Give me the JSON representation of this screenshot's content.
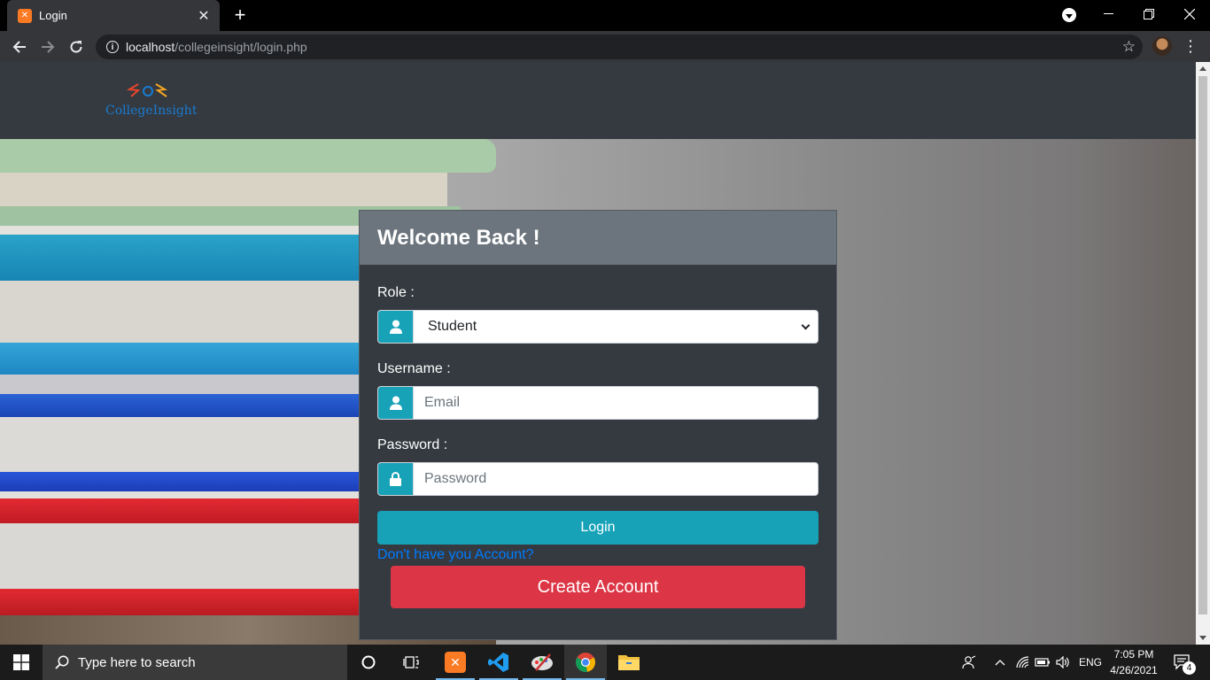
{
  "browser": {
    "tab_title": "Login",
    "url_host": "localhost",
    "url_path": "/collegeinsight/login.php"
  },
  "site": {
    "logo_text": "CollegeInsight"
  },
  "login_card": {
    "title": "Welcome Back !",
    "role_label": "Role :",
    "role_value": "Student",
    "username_label": "Username :",
    "username_placeholder": "Email",
    "password_label": "Password :",
    "password_placeholder": "Password",
    "login_button": "Login",
    "signup_prompt": "Don't have you Account?",
    "create_button": "Create Account"
  },
  "taskbar": {
    "search_placeholder": "Type here to search",
    "language": "ENG",
    "time": "7:05 PM",
    "date": "4/26/2021",
    "notification_count": "4"
  },
  "colors": {
    "primary": "#17a2b8",
    "danger": "#dc3545",
    "link": "#007bff",
    "dark": "#343a40",
    "secondary": "#6c757d"
  }
}
